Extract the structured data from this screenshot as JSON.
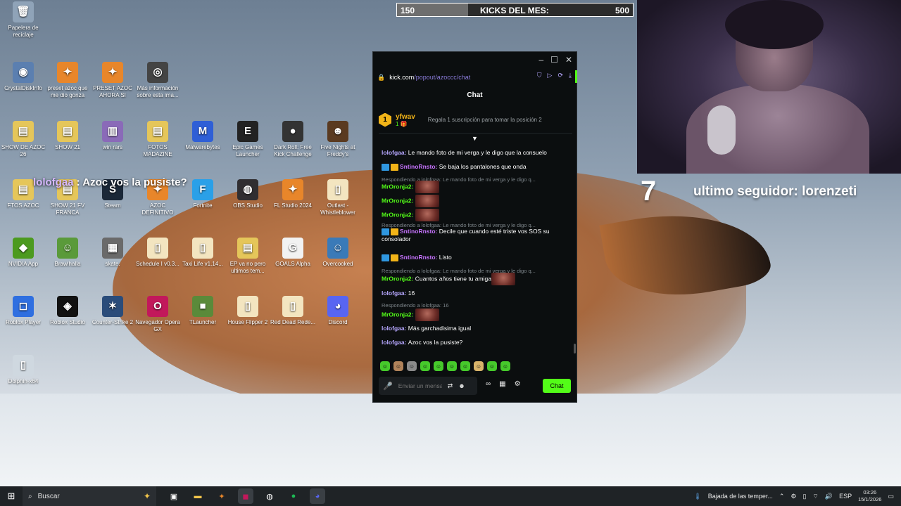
{
  "desktop_icons": [
    {
      "label": "Papelera de reciclaje",
      "glyph": "🗑",
      "icon": "recycle-bin-icon",
      "color": "#8fa3b8"
    },
    {
      "label": "CrystalDiskInfo",
      "glyph": "◉",
      "icon": "crystaldiskinfo-icon",
      "color": "#5b7fb0"
    },
    {
      "label": "preset azoc que me dio gonza",
      "glyph": "✦",
      "icon": "fl-studio-icon",
      "color": "#e8862a"
    },
    {
      "label": "PRESET AZOC AHORA SI",
      "glyph": "✦",
      "icon": "fl-studio-icon",
      "color": "#e8862a"
    },
    {
      "label": "Más información sobre esta ima...",
      "glyph": "◎",
      "icon": "info-camera-icon",
      "color": "#444444"
    },
    {
      "label": "SHOW DE AZOC 26",
      "glyph": "▤",
      "icon": "folder-icon",
      "color": "#e5c65a"
    },
    {
      "label": "SHOW 21",
      "glyph": "▤",
      "icon": "folder-icon",
      "color": "#e5c65a"
    },
    {
      "label": "win rars",
      "glyph": "▥",
      "icon": "winrar-icon",
      "color": "#8a6ab8"
    },
    {
      "label": "FOTOS MADAZINE",
      "glyph": "▤",
      "icon": "folder-icon",
      "color": "#e5c65a"
    },
    {
      "label": "Malwarebytes",
      "glyph": "M",
      "icon": "malwarebytes-icon",
      "color": "#2f5fd6"
    },
    {
      "label": "Epic Games Launcher",
      "glyph": "E",
      "icon": "epic-games-icon",
      "color": "#222222"
    },
    {
      "label": "Dark Roll: Free Kick Challenge",
      "glyph": "●",
      "icon": "soccer-ball-icon",
      "color": "#333333"
    },
    {
      "label": "Five Nights at Freddy's",
      "glyph": "☻",
      "icon": "fnaf-icon",
      "color": "#5a3a20"
    },
    {
      "label": "FTOS AZOC",
      "glyph": "▤",
      "icon": "folder-icon",
      "color": "#e5c65a"
    },
    {
      "label": "SHOW 21 FV FRANCA",
      "glyph": "▤",
      "icon": "folder-icon",
      "color": "#e5c65a"
    },
    {
      "label": "Steam",
      "glyph": "S",
      "icon": "steam-icon",
      "color": "#1b2838"
    },
    {
      "label": "AZOC DEFINITIVO",
      "glyph": "✦",
      "icon": "fl-studio-icon",
      "color": "#e8862a"
    },
    {
      "label": "Fortnite",
      "glyph": "F",
      "icon": "fortnite-icon",
      "color": "#2aa0e8"
    },
    {
      "label": "OBS Studio",
      "glyph": "◍",
      "icon": "obs-icon",
      "color": "#302e31"
    },
    {
      "label": "FL Studio 2024",
      "glyph": "✦",
      "icon": "fl-studio-icon",
      "color": "#e8862a"
    },
    {
      "label": "Outlast - Whistleblower",
      "glyph": "▯",
      "icon": "file-icon",
      "color": "#f3e5c0"
    },
    {
      "label": "NVIDIA App",
      "glyph": "◆",
      "icon": "nvidia-icon",
      "color": "#4c9a1f"
    },
    {
      "label": "Brawlhalla",
      "glyph": "☺",
      "icon": "brawlhalla-icon",
      "color": "#5a9a3a"
    },
    {
      "label": "skate.",
      "glyph": "▦",
      "icon": "skate-icon",
      "color": "#6a6a6a"
    },
    {
      "label": "Schedule I v0.3...",
      "glyph": "▯",
      "icon": "file-icon",
      "color": "#f3e5c0"
    },
    {
      "label": "Taxi Life v1.14...",
      "glyph": "▯",
      "icon": "file-icon",
      "color": "#f3e5c0"
    },
    {
      "label": "EP va no pero ultimos tem...",
      "glyph": "▤",
      "icon": "folder-icon",
      "color": "#e5c65a"
    },
    {
      "label": "GOALS Alpha",
      "glyph": "G",
      "icon": "goals-icon",
      "color": "#f2f2f2"
    },
    {
      "label": "Overcooked",
      "glyph": "☺",
      "icon": "overcooked-icon",
      "color": "#3a7ab8"
    },
    {
      "label": "Roblox Player",
      "glyph": "◻",
      "icon": "roblox-player-icon",
      "color": "#2f6fe0"
    },
    {
      "label": "Roblox Studio",
      "glyph": "◈",
      "icon": "roblox-studio-icon",
      "color": "#111111"
    },
    {
      "label": "Counter-Strike 2",
      "glyph": "✶",
      "icon": "counter-strike-icon",
      "color": "#2a4c7a"
    },
    {
      "label": "Navegador Opera GX",
      "glyph": "O",
      "icon": "opera-gx-icon",
      "color": "#c2185b"
    },
    {
      "label": "TLauncher",
      "glyph": "■",
      "icon": "tlauncher-icon",
      "color": "#5a8a3a"
    },
    {
      "label": "House Flipper 2",
      "glyph": "▯",
      "icon": "file-icon",
      "color": "#f3e5c0"
    },
    {
      "label": "Red Dead Rede...",
      "glyph": "▯",
      "icon": "file-icon",
      "color": "#f3e5c0"
    },
    {
      "label": "Discord",
      "glyph": "◕",
      "icon": "discord-icon",
      "color": "#5865f2"
    },
    {
      "label": "Dolphin-x64",
      "glyph": "▯",
      "icon": "file-icon",
      "color": "#cfd8e0"
    }
  ],
  "kicks": {
    "current": "150",
    "label": "KICKS DEL MES:",
    "goal": "500",
    "progress": 0.3
  },
  "stream_overlay": {
    "counter": "7",
    "last_follower": "ultimo seguidor: lorenzeti",
    "tts_user": "lolofgaa",
    "tts_text": " : Azoc vos la pusiste?"
  },
  "chat_window": {
    "url_host": "kick.com",
    "url_path": "/popout/azoccc/chat",
    "title": "Chat",
    "pinned": {
      "user": "yfwav",
      "level": "1",
      "subs": "1 🎁",
      "info": "Regala 1 suscripción para tomar la posición 2"
    },
    "messages": [
      {
        "user": "lolofgaa",
        "text": "Le mando foto de mi verga y le digo que la consuelo"
      },
      {
        "user": "SntinoRnsto",
        "text": "Se baja los pantalones que onda"
      },
      {
        "reply": "Respondiendo a lolofgaa: Le mando foto de mi verga y le digo q..."
      },
      {
        "user": "MrOronja2",
        "text": ""
      },
      {
        "user": "MrOronja2",
        "text": ""
      },
      {
        "user": "MrOronja2",
        "text": ""
      },
      {
        "reply": "Respondiendo a lolofgaa: Le mando foto de mi verga y le digo q..."
      },
      {
        "user": "SntinoRnsto",
        "text": "Decile que cuando esté triste vos SOS su consolador"
      },
      {
        "user": "SntinoRnsto",
        "text": "Listo"
      },
      {
        "reply": "Respondiendo a lolofgaa: Le mando foto de mi verga y le digo q..."
      },
      {
        "user": "MrOronja2",
        "text": "Cuantos años tiene tu amiga"
      },
      {
        "user": "lolofgaa",
        "text": "16"
      },
      {
        "reply": "Respondiendo a lolofgaa: 16"
      },
      {
        "user": "MrOronja2",
        "text": ""
      },
      {
        "user": "lolofgaa",
        "text": "Más garchadisima igual"
      },
      {
        "user": "lolofgaa",
        "text": "Azoc vos la pusiste?"
      }
    ],
    "input_placeholder": "Enviar un mensaje",
    "send_label": "Chat",
    "accent": "#53fc18"
  },
  "taskbar": {
    "search_placeholder": "Buscar",
    "weather": "Bajada de las temper...",
    "language": "ESP",
    "time": "03:26",
    "date": "15/1/2026"
  }
}
